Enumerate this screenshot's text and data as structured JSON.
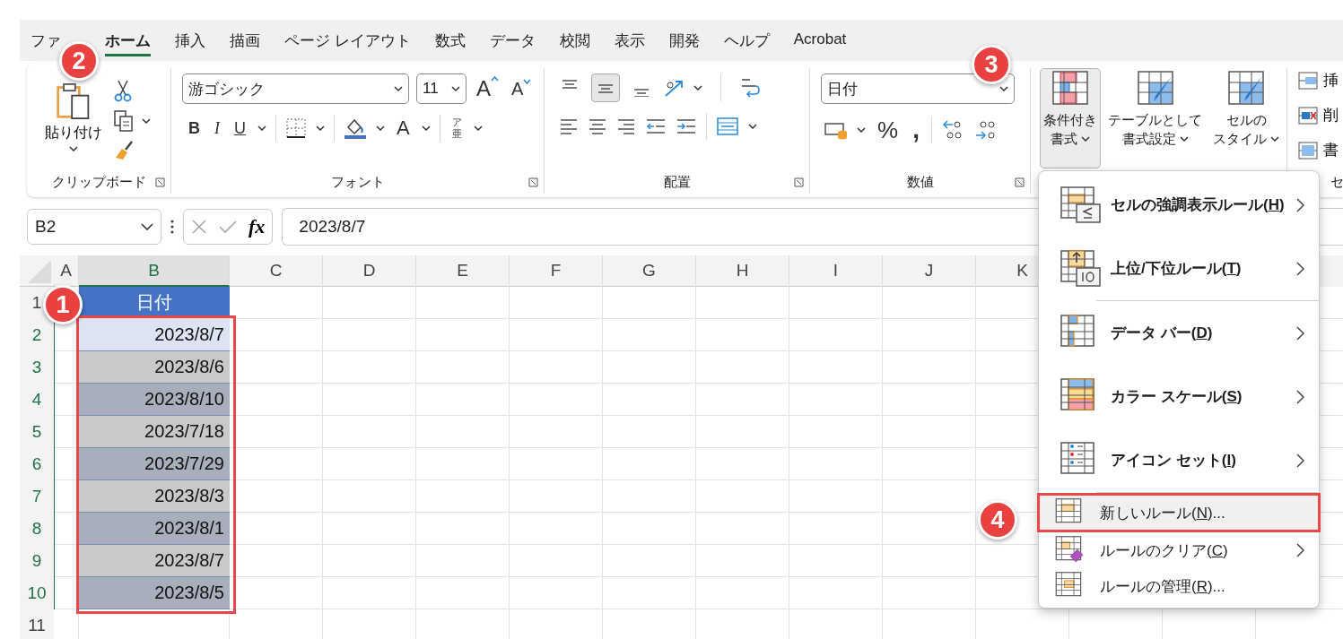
{
  "tabs": [
    {
      "label": "ファ",
      "selected": false
    },
    {
      "label": "ホーム",
      "selected": true
    },
    {
      "label": "挿入",
      "selected": false
    },
    {
      "label": "描画",
      "selected": false
    },
    {
      "label": "ページ レイアウト",
      "selected": false
    },
    {
      "label": "数式",
      "selected": false
    },
    {
      "label": "データ",
      "selected": false
    },
    {
      "label": "校閲",
      "selected": false
    },
    {
      "label": "表示",
      "selected": false
    },
    {
      "label": "開発",
      "selected": false
    },
    {
      "label": "ヘルプ",
      "selected": false
    },
    {
      "label": "Acrobat",
      "selected": false
    }
  ],
  "ribbon": {
    "clipboard": {
      "paste": "貼り付け",
      "label": "クリップボード"
    },
    "font": {
      "font_name": "游ゴシック",
      "font_size": "11",
      "grow": "A",
      "shrink": "A",
      "bold": "B",
      "italic": "I",
      "underline": "U",
      "font_color": "A",
      "phonetic_top": "ア",
      "phonetic_bottom": "亜",
      "label": "フォント"
    },
    "alignment": {
      "vertical": [
        {
          "selected": false
        },
        {
          "selected": true
        },
        {
          "selected": false
        }
      ],
      "label": "配置"
    },
    "number": {
      "format": "日付",
      "percent": "%",
      "comma": ",",
      "label": "数値"
    },
    "styles": [
      {
        "lines": [
          "条件付き",
          "書式"
        ],
        "selected": true
      },
      {
        "lines": [
          "テーブルとして",
          "書式設定"
        ],
        "selected": false
      },
      {
        "lines": [
          "セルの",
          "スタイル"
        ],
        "selected": false
      }
    ],
    "cells": {
      "items": [
        "挿",
        "削",
        "書"
      ],
      "label": "セ"
    }
  },
  "formula_bar": {
    "name_box": "B2",
    "function_label": "fx",
    "value": "2023/8/7"
  },
  "sheet": {
    "columns": [
      {
        "label": "A",
        "selected": false
      },
      {
        "label": "B",
        "selected": true
      },
      {
        "label": "C",
        "selected": false
      },
      {
        "label": "D",
        "selected": false
      },
      {
        "label": "E",
        "selected": false
      },
      {
        "label": "F",
        "selected": false
      },
      {
        "label": "G",
        "selected": false
      },
      {
        "label": "H",
        "selected": false
      },
      {
        "label": "I",
        "selected": false
      },
      {
        "label": "J",
        "selected": false
      },
      {
        "label": "K",
        "selected": false
      }
    ],
    "rows": [
      {
        "number": "1",
        "selected": false,
        "kind": "heading",
        "b": "日付",
        "color": "#4472c4"
      },
      {
        "number": "2",
        "selected": true,
        "kind": "date",
        "b": "2023/8/7",
        "color": "#dde3f3"
      },
      {
        "number": "3",
        "selected": true,
        "kind": "date",
        "b": "2023/8/6",
        "color": "#c9c9c9"
      },
      {
        "number": "4",
        "selected": true,
        "kind": "date",
        "b": "2023/8/10",
        "color": "#a8aebb"
      },
      {
        "number": "5",
        "selected": true,
        "kind": "date",
        "b": "2023/7/18",
        "color": "#c9c9c9"
      },
      {
        "number": "6",
        "selected": true,
        "kind": "date",
        "b": "2023/7/29",
        "color": "#a8aebb"
      },
      {
        "number": "7",
        "selected": true,
        "kind": "date",
        "b": "2023/8/3",
        "color": "#c9c9c9"
      },
      {
        "number": "8",
        "selected": true,
        "kind": "date",
        "b": "2023/8/1",
        "color": "#a8aebb"
      },
      {
        "number": "9",
        "selected": true,
        "kind": "date",
        "b": "2023/8/7",
        "color": "#c9c9c9"
      },
      {
        "number": "10",
        "selected": true,
        "kind": "date",
        "b": "2023/8/5",
        "color": "#a8aebb"
      },
      {
        "number": "11",
        "selected": false,
        "kind": "empty"
      }
    ]
  },
  "menu": {
    "items": [
      {
        "kind": "large",
        "label": "セルの強調表示ルール(",
        "mnemonic": "H",
        "tail": ")",
        "submenu": true,
        "selected": false,
        "separator_after": false
      },
      {
        "kind": "large",
        "label": "上位/下位ルール(",
        "mnemonic": "T",
        "tail": ")",
        "submenu": true,
        "selected": false,
        "separator_after": true
      },
      {
        "kind": "large",
        "label": "データ バー(",
        "mnemonic": "D",
        "tail": ")",
        "submenu": true,
        "selected": false,
        "separator_after": false
      },
      {
        "kind": "large",
        "label": "カラー スケール(",
        "mnemonic": "S",
        "tail": ")",
        "submenu": true,
        "selected": false,
        "separator_after": false
      },
      {
        "kind": "large",
        "label": "アイコン セット(",
        "mnemonic": "I",
        "tail": ")",
        "submenu": true,
        "selected": false,
        "separator_after": true
      },
      {
        "kind": "small",
        "label": "新しいルール(",
        "mnemonic": "N",
        "tail": ")...",
        "submenu": false,
        "selected": true,
        "separator_after": false
      },
      {
        "kind": "small",
        "label": "ルールのクリア(",
        "mnemonic": "C",
        "tail": ")",
        "submenu": true,
        "selected": false,
        "separator_after": false
      },
      {
        "kind": "small",
        "label": "ルールの管理(",
        "mnemonic": "R",
        "tail": ")...",
        "submenu": false,
        "selected": false,
        "separator_after": false
      }
    ]
  },
  "badges": [
    "1",
    "2",
    "3",
    "4"
  ]
}
